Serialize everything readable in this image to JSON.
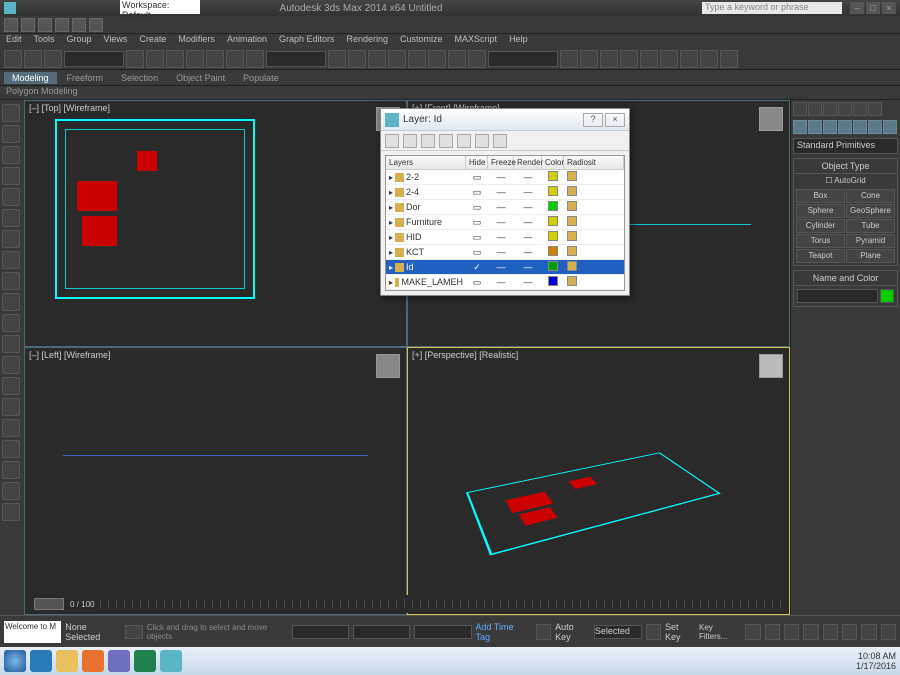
{
  "app": {
    "title": "Autodesk 3ds Max 2014 x64   Untitled",
    "workspace": "Workspace: Default",
    "search_placeholder": "Type a keyword or phrase"
  },
  "menu": [
    "Edit",
    "Tools",
    "Group",
    "Views",
    "Create",
    "Modifiers",
    "Animation",
    "Graph Editors",
    "Rendering",
    "Customize",
    "MAXScript",
    "Help"
  ],
  "ribbon": {
    "tabs": [
      "Modeling",
      "Freeform",
      "Selection",
      "Object Paint",
      "Populate"
    ],
    "sub": "Polygon Modeling"
  },
  "viewports": {
    "tl": "[–] [Top] [Wireframe]",
    "tr": "[+] [Front] [Wireframe]",
    "bl": "[–] [Left] [Wireframe]",
    "br": "[+] [Perspective] [Realistic]"
  },
  "cmdpanel": {
    "dropdown": "Standard Primitives",
    "rollout1": "Object Type",
    "autogrid": "AutoGrid",
    "objects": [
      "Box",
      "Cone",
      "Sphere",
      "GeoSphere",
      "Cylinder",
      "Tube",
      "Torus",
      "Pyramid",
      "Teapot",
      "Plane"
    ],
    "rollout2": "Name and Color"
  },
  "layerdlg": {
    "title": "Layer: Id",
    "headers": [
      "Layers",
      "Hide",
      "Freeze",
      "Render",
      "Color",
      "Radiosit"
    ],
    "rows": [
      {
        "name": "2-2",
        "color": "#d0d000"
      },
      {
        "name": "2-4",
        "color": "#d0d000"
      },
      {
        "name": "Dor",
        "color": "#00d000"
      },
      {
        "name": "Furniture",
        "color": "#d0d000"
      },
      {
        "name": "HID",
        "color": "#d0d000"
      },
      {
        "name": "KCT",
        "color": "#d08000"
      },
      {
        "name": "Id",
        "color": "#00a000",
        "selected": true
      },
      {
        "name": "MAKE_LAMEH",
        "color": "#0000d0"
      }
    ]
  },
  "timeline": {
    "frame": "0 / 100"
  },
  "status": {
    "welcome": "Welcome to M",
    "none": "None Selected",
    "hint": "Click and drag to select and move objects",
    "timetag": "Add Time Tag",
    "autokey": "Auto Key",
    "setkey": "Set Key",
    "selected": "Selected",
    "keyfilters": "Key Filters..."
  },
  "taskbar": {
    "time": "10:08 AM",
    "date": "1/17/2016"
  }
}
